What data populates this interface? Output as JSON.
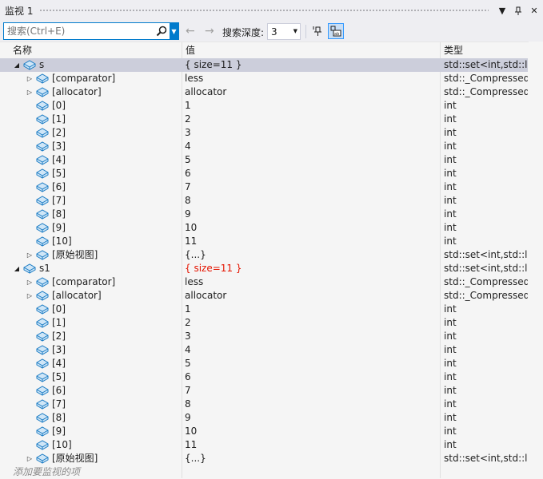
{
  "window": {
    "title": "监视 1",
    "menu_arrow": "▼",
    "pin": "📌",
    "close": "✕"
  },
  "toolbar": {
    "search_placeholder": "搜索(Ctrl+E)",
    "depth_label": "搜索深度:",
    "depth_value": "3",
    "back": "←",
    "forward": "→"
  },
  "columns": {
    "name": "名称",
    "value": "值",
    "type": "类型"
  },
  "rows": [
    {
      "level": 0,
      "expander": "◢",
      "name": "s",
      "value": "{ size=11 }",
      "type": "std::set<int,std::le...",
      "selected": true,
      "changed": false
    },
    {
      "level": 1,
      "expander": "▷",
      "name": "[comparator]",
      "value": "less",
      "type": "std::_Compressed...",
      "selected": false,
      "changed": false
    },
    {
      "level": 1,
      "expander": "▷",
      "name": "[allocator]",
      "value": "allocator",
      "type": "std::_Compressed...",
      "selected": false,
      "changed": false
    },
    {
      "level": 1,
      "expander": "",
      "name": "[0]",
      "value": "1",
      "type": "int",
      "selected": false,
      "changed": false
    },
    {
      "level": 1,
      "expander": "",
      "name": "[1]",
      "value": "2",
      "type": "int",
      "selected": false,
      "changed": false
    },
    {
      "level": 1,
      "expander": "",
      "name": "[2]",
      "value": "3",
      "type": "int",
      "selected": false,
      "changed": false
    },
    {
      "level": 1,
      "expander": "",
      "name": "[3]",
      "value": "4",
      "type": "int",
      "selected": false,
      "changed": false
    },
    {
      "level": 1,
      "expander": "",
      "name": "[4]",
      "value": "5",
      "type": "int",
      "selected": false,
      "changed": false
    },
    {
      "level": 1,
      "expander": "",
      "name": "[5]",
      "value": "6",
      "type": "int",
      "selected": false,
      "changed": false
    },
    {
      "level": 1,
      "expander": "",
      "name": "[6]",
      "value": "7",
      "type": "int",
      "selected": false,
      "changed": false
    },
    {
      "level": 1,
      "expander": "",
      "name": "[7]",
      "value": "8",
      "type": "int",
      "selected": false,
      "changed": false
    },
    {
      "level": 1,
      "expander": "",
      "name": "[8]",
      "value": "9",
      "type": "int",
      "selected": false,
      "changed": false
    },
    {
      "level": 1,
      "expander": "",
      "name": "[9]",
      "value": "10",
      "type": "int",
      "selected": false,
      "changed": false
    },
    {
      "level": 1,
      "expander": "",
      "name": "[10]",
      "value": "11",
      "type": "int",
      "selected": false,
      "changed": false
    },
    {
      "level": 1,
      "expander": "▷",
      "name": "[原始视图]",
      "value": "{...}",
      "type": "std::set<int,std::le...",
      "selected": false,
      "changed": false
    },
    {
      "level": 0,
      "expander": "◢",
      "name": "s1",
      "value": "{ size=11 }",
      "type": "std::set<int,std::le...",
      "selected": false,
      "changed": true
    },
    {
      "level": 1,
      "expander": "▷",
      "name": "[comparator]",
      "value": "less",
      "type": "std::_Compressed...",
      "selected": false,
      "changed": false
    },
    {
      "level": 1,
      "expander": "▷",
      "name": "[allocator]",
      "value": "allocator",
      "type": "std::_Compressed...",
      "selected": false,
      "changed": false
    },
    {
      "level": 1,
      "expander": "",
      "name": "[0]",
      "value": "1",
      "type": "int",
      "selected": false,
      "changed": false
    },
    {
      "level": 1,
      "expander": "",
      "name": "[1]",
      "value": "2",
      "type": "int",
      "selected": false,
      "changed": false
    },
    {
      "level": 1,
      "expander": "",
      "name": "[2]",
      "value": "3",
      "type": "int",
      "selected": false,
      "changed": false
    },
    {
      "level": 1,
      "expander": "",
      "name": "[3]",
      "value": "4",
      "type": "int",
      "selected": false,
      "changed": false
    },
    {
      "level": 1,
      "expander": "",
      "name": "[4]",
      "value": "5",
      "type": "int",
      "selected": false,
      "changed": false
    },
    {
      "level": 1,
      "expander": "",
      "name": "[5]",
      "value": "6",
      "type": "int",
      "selected": false,
      "changed": false
    },
    {
      "level": 1,
      "expander": "",
      "name": "[6]",
      "value": "7",
      "type": "int",
      "selected": false,
      "changed": false
    },
    {
      "level": 1,
      "expander": "",
      "name": "[7]",
      "value": "8",
      "type": "int",
      "selected": false,
      "changed": false
    },
    {
      "level": 1,
      "expander": "",
      "name": "[8]",
      "value": "9",
      "type": "int",
      "selected": false,
      "changed": false
    },
    {
      "level": 1,
      "expander": "",
      "name": "[9]",
      "value": "10",
      "type": "int",
      "selected": false,
      "changed": false
    },
    {
      "level": 1,
      "expander": "",
      "name": "[10]",
      "value": "11",
      "type": "int",
      "selected": false,
      "changed": false
    },
    {
      "level": 1,
      "expander": "▷",
      "name": "[原始视图]",
      "value": "{...}",
      "type": "std::set<int,std::le...",
      "selected": false,
      "changed": false
    }
  ],
  "add_watch_placeholder": "添加要监视的项",
  "colors": {
    "accent": "#007acc",
    "selected_row": "#cccedb",
    "changed_value": "#e51400",
    "icon_fill": "#a8d4ef",
    "icon_stroke": "#1c7cc4"
  }
}
